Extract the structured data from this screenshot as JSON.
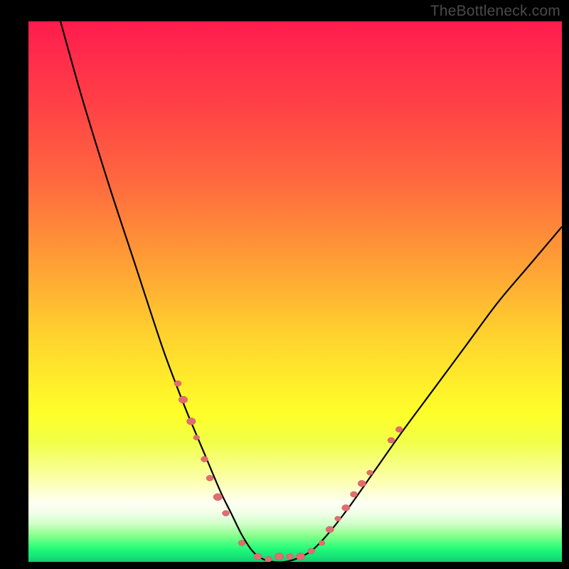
{
  "watermark": "TheBottleneck.com",
  "chart_data": {
    "type": "line",
    "title": "",
    "xlabel": "",
    "ylabel": "",
    "xlim": [
      0,
      100
    ],
    "ylim": [
      0,
      100
    ],
    "series": [
      {
        "name": "bottleneck-curve",
        "x": [
          6,
          10,
          15,
          20,
          25,
          28,
          30,
          33,
          36,
          38,
          40,
          42,
          44,
          46,
          48,
          50,
          53,
          56,
          60,
          65,
          70,
          76,
          82,
          88,
          94,
          100
        ],
        "y": [
          100,
          86,
          70,
          55,
          40,
          32,
          27,
          20,
          13,
          9,
          5,
          2,
          0.5,
          0,
          0,
          0.5,
          2,
          5,
          10,
          17,
          24,
          32,
          40,
          48,
          55,
          62
        ]
      }
    ],
    "markers": {
      "name": "data-points",
      "color": "#e06d70",
      "points": [
        {
          "x": 28,
          "y": 33,
          "r": 4
        },
        {
          "x": 29,
          "y": 30,
          "r": 5
        },
        {
          "x": 30.5,
          "y": 26,
          "r": 5
        },
        {
          "x": 31.5,
          "y": 23,
          "r": 3.5
        },
        {
          "x": 33,
          "y": 19,
          "r": 4
        },
        {
          "x": 34,
          "y": 15.5,
          "r": 4
        },
        {
          "x": 35.5,
          "y": 12,
          "r": 5
        },
        {
          "x": 37,
          "y": 9,
          "r": 4
        },
        {
          "x": 40,
          "y": 3.5,
          "r": 4
        },
        {
          "x": 43,
          "y": 1,
          "r": 4.5
        },
        {
          "x": 45,
          "y": 0.5,
          "r": 4
        },
        {
          "x": 47,
          "y": 1,
          "r": 5
        },
        {
          "x": 49,
          "y": 1,
          "r": 4
        },
        {
          "x": 51,
          "y": 1,
          "r": 5
        },
        {
          "x": 53,
          "y": 2,
          "r": 4
        },
        {
          "x": 55,
          "y": 3.5,
          "r": 3.5
        },
        {
          "x": 56.5,
          "y": 6,
          "r": 4.5
        },
        {
          "x": 58,
          "y": 8,
          "r": 3.5
        },
        {
          "x": 59.5,
          "y": 10,
          "r": 4.5
        },
        {
          "x": 61,
          "y": 12.5,
          "r": 4
        },
        {
          "x": 62.5,
          "y": 14.5,
          "r": 4.5
        },
        {
          "x": 64,
          "y": 16.5,
          "r": 3.5
        },
        {
          "x": 68,
          "y": 22.5,
          "r": 4
        },
        {
          "x": 69.5,
          "y": 24.5,
          "r": 4
        }
      ]
    },
    "gradient": {
      "top": "#ff1b4c",
      "mid": "#fff12a",
      "bottom": "#0fce70"
    }
  }
}
